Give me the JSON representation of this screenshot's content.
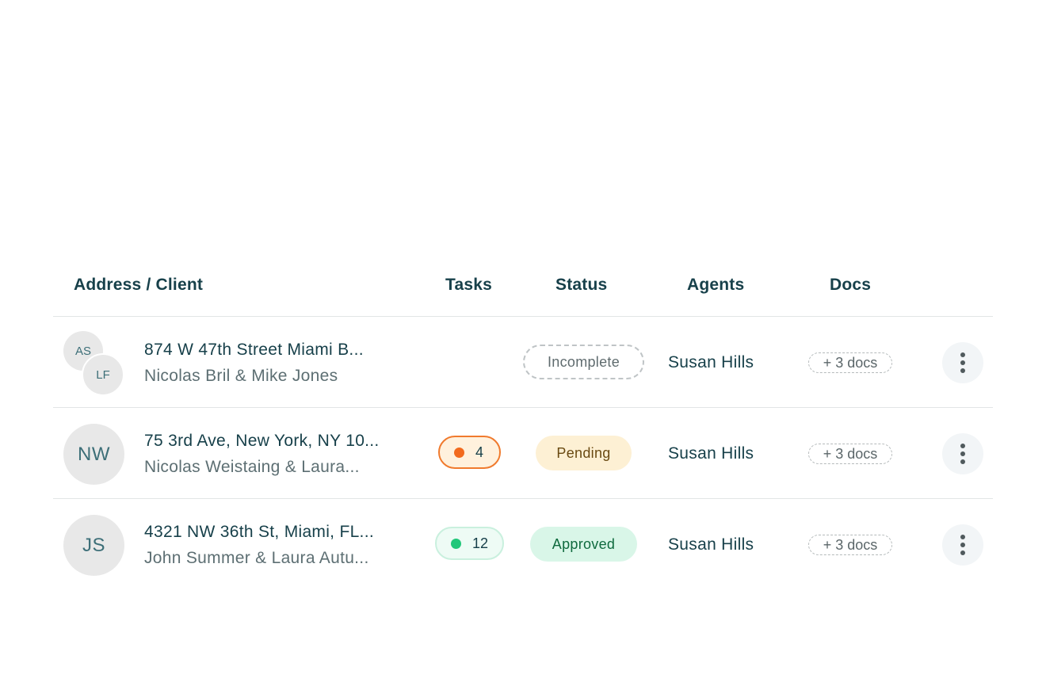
{
  "table": {
    "columns": [
      "Address / Client",
      "Tasks",
      "Status",
      "Agents",
      "Docs"
    ],
    "rows": [
      {
        "avatars": [
          "AS",
          "LF"
        ],
        "address": "874 W 47th Street Miami B...",
        "client": "Nicolas Bril & Mike Jones",
        "tasks": null,
        "status": "Incomplete",
        "agent": "Susan Hills",
        "docs": "+ 3 docs"
      },
      {
        "avatars": [
          "NW"
        ],
        "address": "75 3rd Ave, New York, NY 10...",
        "client": "Nicolas Weistaing & Laura...",
        "tasks": "4",
        "status": "Pending",
        "agent": "Susan Hills",
        "docs": "+ 3 docs"
      },
      {
        "avatars": [
          "JS"
        ],
        "address": "4321 NW 36th St, Miami, FL...",
        "client": "John Summer & Laura Autu...",
        "tasks": "12",
        "status": "Approved",
        "agent": "Susan Hills",
        "docs": "+ 3 docs"
      }
    ]
  },
  "colors": {
    "text_primary": "#17404a",
    "text_secondary": "#5d6f73",
    "tasks_orange": "#f26a1e",
    "tasks_green": "#22c77a",
    "pending_bg": "#fdf0d4",
    "approved_bg": "#d9f6e8"
  },
  "icons": {
    "more": "more-vertical-icon",
    "task_dot": "status-dot-icon"
  }
}
